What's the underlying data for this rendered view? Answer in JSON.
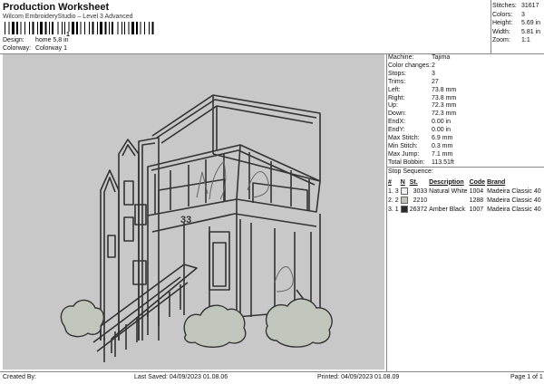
{
  "header": {
    "title": "Production Worksheet",
    "subtitle": "Wilcom EmbroideryStudio – Level 3 Advanced",
    "barcode_number": "1"
  },
  "meta": {
    "design_label": "Design:",
    "design_value": "home 5,8 in",
    "colorway_label": "Colorway:",
    "colorway_value": "Colorway 1"
  },
  "top_stats": [
    {
      "label": "Stitches:",
      "value": "31617"
    },
    {
      "label": "Colors:",
      "value": "3"
    },
    {
      "label": "Height:",
      "value": "5.69 in"
    },
    {
      "label": "Width:",
      "value": "5.81 in"
    },
    {
      "label": "Zoom:",
      "value": "1:1"
    }
  ],
  "machine_info": [
    {
      "label": "Machine:",
      "value": "Tajima"
    },
    {
      "label": "Color changes:",
      "value": "2"
    },
    {
      "label": "Stops:",
      "value": "3"
    },
    {
      "label": "Trims:",
      "value": "27"
    },
    {
      "label": "Left:",
      "value": "73.8 mm"
    },
    {
      "label": "Right:",
      "value": "73.8 mm"
    },
    {
      "label": "Up:",
      "value": "72.3 mm"
    },
    {
      "label": "Down:",
      "value": "72.3 mm"
    },
    {
      "label": "EndX:",
      "value": "0.00 in"
    },
    {
      "label": "EndY:",
      "value": "0.00 in"
    },
    {
      "label": "Max Stitch:",
      "value": "6.9 mm"
    },
    {
      "label": "Min Stitch:",
      "value": "0.3 mm"
    },
    {
      "label": "Max Jump:",
      "value": "7.1 mm"
    },
    {
      "label": "Total Bobbin:",
      "value": "113.51ft"
    }
  ],
  "stop_sequence": {
    "title": "Stop Sequence:",
    "headers": [
      "#",
      "N",
      "St.",
      "Description",
      "Code",
      "Brand"
    ],
    "rows": [
      {
        "num": "1.",
        "n": "3",
        "color": "#f2f2f0",
        "st": "3033",
        "desc": "Natural White",
        "code": "1004",
        "brand": "Madeira Classic 40"
      },
      {
        "num": "2.",
        "n": "2",
        "color": "#c0c6bc",
        "st": "2210",
        "desc": "",
        "code": "1288",
        "brand": "Madeira Classic 40"
      },
      {
        "num": "3.",
        "n": "1",
        "color": "#2a2a28",
        "st": "26372",
        "desc": "Amber Black",
        "code": "1007",
        "brand": "Madeira Classic 40"
      }
    ]
  },
  "design_label_33": "33",
  "footer": {
    "created_by": "Created By:",
    "last_saved": "Last Saved: 04/09/2023 01.08.06",
    "printed": "Printed: 04/09/2023 01.08.09",
    "page": "Page 1 of 1"
  },
  "colors": {
    "design_bg": "#c8c8c8",
    "outline": "#333333",
    "bush_fill": "#c0c6bc"
  }
}
